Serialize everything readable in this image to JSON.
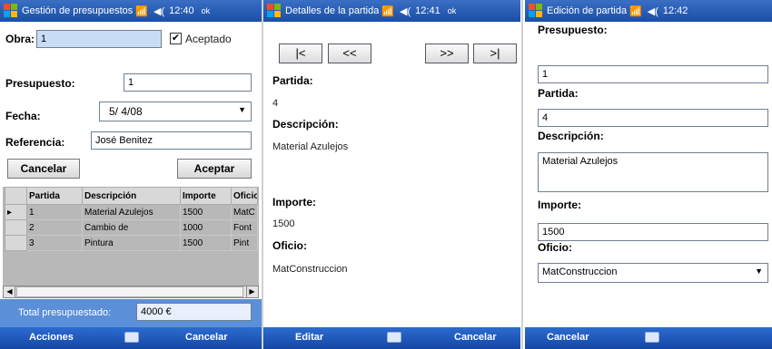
{
  "status": {
    "signal": "📶",
    "volume": "◀(",
    "ok": "ok"
  },
  "screen1": {
    "title": "Gestión de presupuestos",
    "time": "12:40",
    "obra_label": "Obra:",
    "obra_value": "1",
    "aceptado_label": "Aceptado",
    "aceptado_checked": "✔",
    "presupuesto_label": "Presupuesto:",
    "presupuesto_value": "1",
    "fecha_label": "Fecha:",
    "fecha_value": "5/ 4/08",
    "referencia_label": "Referencia:",
    "referencia_value": "José Benitez",
    "cancel_button": "Cancelar",
    "accept_button": "Aceptar",
    "columns": [
      "Partida",
      "Descripción",
      "Importe",
      "Oficio"
    ],
    "rows": [
      [
        "1",
        "Material Azulejos",
        "1500",
        "MatC"
      ],
      [
        "2",
        "Cambio de",
        "1000",
        "Font"
      ],
      [
        "3",
        "Pintura",
        "1500",
        "Pint"
      ]
    ],
    "row_marker": "▸",
    "total_label": "Total presupuestado:",
    "total_value": "4000 €",
    "menu_left": "Acciones",
    "menu_right": "Cancelar"
  },
  "screen2": {
    "title": "Detalles de la partida",
    "time": "12:41",
    "nav_first": "|<",
    "nav_prev": "<<",
    "nav_next": ">>",
    "nav_last": ">|",
    "partida_label": "Partida:",
    "partida_value": "4",
    "descripcion_label": "Descripción:",
    "descripcion_value": "Material Azulejos",
    "importe_label": "Importe:",
    "importe_value": "1500",
    "oficio_label": "Oficio:",
    "oficio_value": "MatConstruccion",
    "menu_left": "Editar",
    "menu_right": "Cancelar"
  },
  "screen3": {
    "title": "Edición de partida",
    "time": "12:42",
    "presupuesto_label": "Presupuesto:",
    "presupuesto_value": "1",
    "partida_label": "Partida:",
    "partida_value": "4",
    "descripcion_label": "Descripción:",
    "descripcion_value": "Material Azulejos",
    "importe_label": "Importe:",
    "importe_value": "1500",
    "oficio_label": "Oficio:",
    "oficio_value": "MatConstruccion",
    "menu_left": "Cancelar"
  }
}
